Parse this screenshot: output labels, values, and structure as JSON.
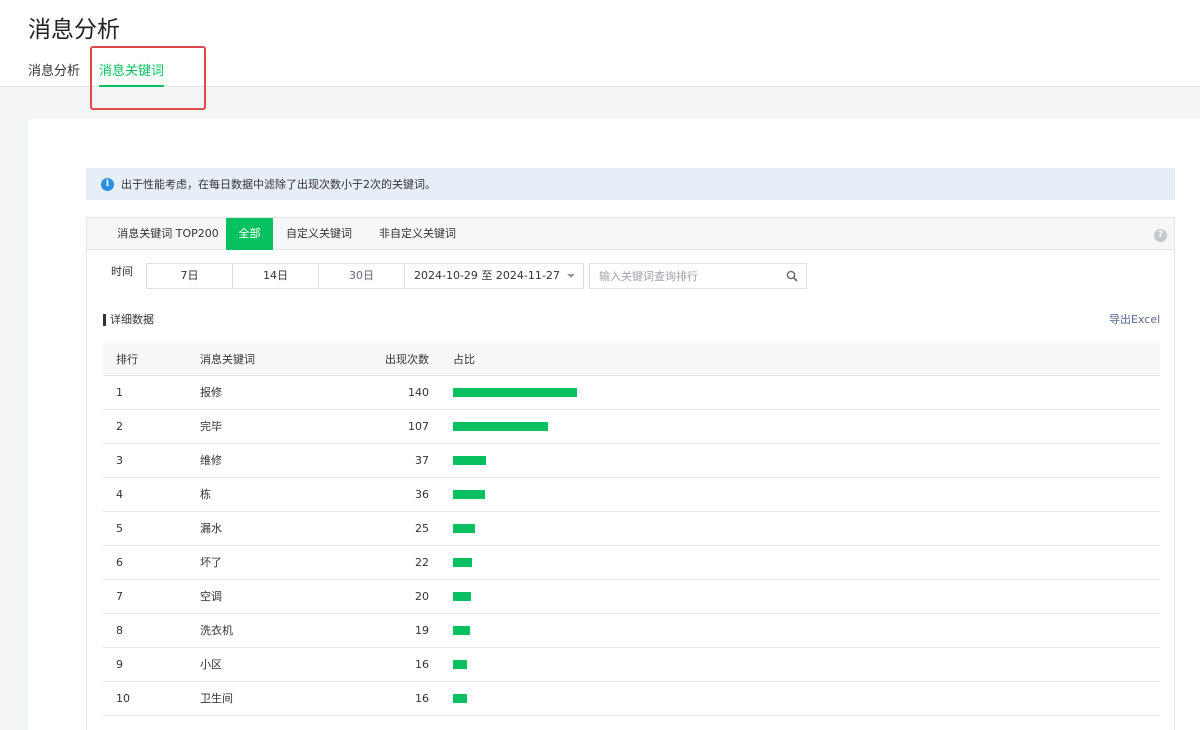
{
  "page": {
    "title": "消息分析"
  },
  "tabs": [
    {
      "label": "消息分析",
      "active": false
    },
    {
      "label": "消息关键词",
      "active": true
    }
  ],
  "notice": {
    "text": "出于性能考虑，在每日数据中滤除了出现次数小于2次的关键词。"
  },
  "subtabs": [
    {
      "label": "消息关键词 TOP200",
      "active": false
    },
    {
      "label": "全部",
      "active": true
    },
    {
      "label": "自定义关键词",
      "active": false
    },
    {
      "label": "非自定义关键词",
      "active": false
    }
  ],
  "filters": {
    "time_label": "时间",
    "ranges": [
      "7日",
      "14日",
      "30日"
    ],
    "date_range": "2024-10-29 至 2024-11-27",
    "search_placeholder": "输入关键词查询排行"
  },
  "detail": {
    "title": "详细数据",
    "export_label": "导出Excel",
    "columns": [
      "排行",
      "消息关键词",
      "出现次数",
      "占比"
    ],
    "rows": [
      {
        "rank": "1",
        "keyword": "报修",
        "count": "140"
      },
      {
        "rank": "2",
        "keyword": "完毕",
        "count": "107"
      },
      {
        "rank": "3",
        "keyword": "维修",
        "count": "37"
      },
      {
        "rank": "4",
        "keyword": "栋",
        "count": "36"
      },
      {
        "rank": "5",
        "keyword": "漏水",
        "count": "25"
      },
      {
        "rank": "6",
        "keyword": "坏了",
        "count": "22"
      },
      {
        "rank": "7",
        "keyword": "空调",
        "count": "20"
      },
      {
        "rank": "8",
        "keyword": "洗衣机",
        "count": "19"
      },
      {
        "rank": "9",
        "keyword": "小区",
        "count": "16"
      },
      {
        "rank": "10",
        "keyword": "卫生间",
        "count": "16"
      }
    ]
  },
  "colors": {
    "accent": "#07c160",
    "highlight": "#e0484e",
    "link": "#576b95"
  },
  "icons": {
    "info": "info-icon",
    "help": "help-icon",
    "search": "search-icon",
    "dropdown": "caret-down-icon"
  }
}
